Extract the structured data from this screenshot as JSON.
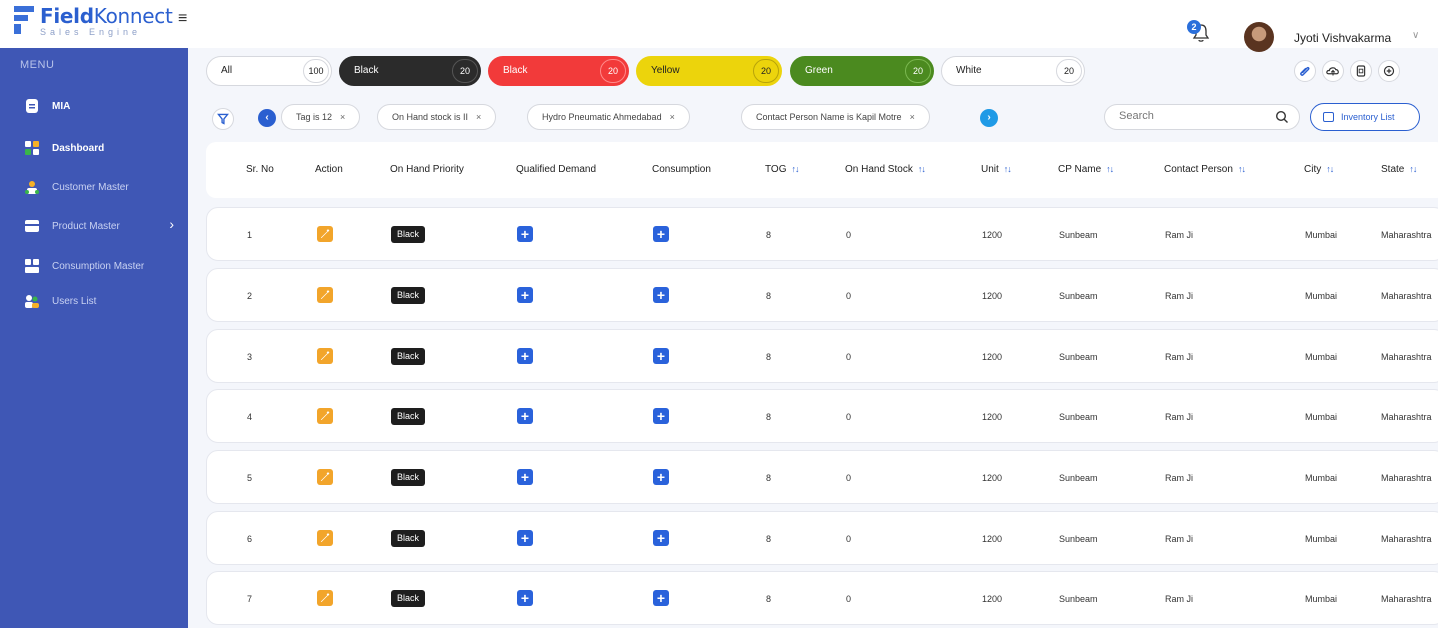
{
  "brand": {
    "name_bold": "Field",
    "name_light": "Konnect",
    "tagline": "Sales Engine",
    "accent": "#2b5fcf"
  },
  "header": {
    "notification_count": "2",
    "user_name": "Jyoti Vishvakarma"
  },
  "sidebar": {
    "menu_title": "MENU",
    "items": [
      {
        "label": "MIA",
        "icon": "document-icon"
      },
      {
        "label": "Dashboard",
        "icon": "dashboard-icon"
      },
      {
        "label": "Customer Master",
        "icon": "customer-icon"
      },
      {
        "label": "Product Master",
        "icon": "product-icon"
      },
      {
        "label": "Consumption Master",
        "icon": "consumption-icon"
      },
      {
        "label": "Users List",
        "icon": "users-icon"
      }
    ]
  },
  "color_filters": [
    {
      "label": "All",
      "count": "100",
      "color": "#ffffff"
    },
    {
      "label": "Black",
      "count": "20",
      "color": "#2b2b2b"
    },
    {
      "label": "Black",
      "count": "20",
      "color": "#f23a3a"
    },
    {
      "label": "Yellow",
      "count": "20",
      "color": "#ecd40c"
    },
    {
      "label": "Green",
      "count": "20",
      "color": "#4b8a1f"
    },
    {
      "label": "White",
      "count": "20",
      "color": "#ffffff"
    }
  ],
  "active_filters": [
    {
      "label": "Tag is 12"
    },
    {
      "label": "On Hand stock is II"
    },
    {
      "label": "Hydro Pneumatic Ahmedabad"
    },
    {
      "label": "Contact Person Name is Kapil Motre"
    }
  ],
  "search": {
    "placeholder": "Search"
  },
  "inventory_button": {
    "label": "Inventory List"
  },
  "table": {
    "columns": [
      "Sr. No",
      "Action",
      "On Hand Priority",
      "Qualified Demand",
      "Consumption",
      "TOG",
      "On Hand Stock",
      "Unit",
      "CP Name",
      "Contact Person",
      "City",
      "State"
    ],
    "rows": [
      {
        "sr": "1",
        "priority": "Black",
        "tog": "8",
        "stock": "0",
        "unit": "1200",
        "cp_name": "Sunbeam",
        "contact": "Ram Ji",
        "city": "Mumbai",
        "state": "Maharashtra"
      },
      {
        "sr": "2",
        "priority": "Black",
        "tog": "8",
        "stock": "0",
        "unit": "1200",
        "cp_name": "Sunbeam",
        "contact": "Ram Ji",
        "city": "Mumbai",
        "state": "Maharashtra"
      },
      {
        "sr": "3",
        "priority": "Black",
        "tog": "8",
        "stock": "0",
        "unit": "1200",
        "cp_name": "Sunbeam",
        "contact": "Ram Ji",
        "city": "Mumbai",
        "state": "Maharashtra"
      },
      {
        "sr": "4",
        "priority": "Black",
        "tog": "8",
        "stock": "0",
        "unit": "1200",
        "cp_name": "Sunbeam",
        "contact": "Ram Ji",
        "city": "Mumbai",
        "state": "Maharashtra"
      },
      {
        "sr": "5",
        "priority": "Black",
        "tog": "8",
        "stock": "0",
        "unit": "1200",
        "cp_name": "Sunbeam",
        "contact": "Ram Ji",
        "city": "Mumbai",
        "state": "Maharashtra"
      },
      {
        "sr": "6",
        "priority": "Black",
        "tog": "8",
        "stock": "0",
        "unit": "1200",
        "cp_name": "Sunbeam",
        "contact": "Ram Ji",
        "city": "Mumbai",
        "state": "Maharashtra"
      },
      {
        "sr": "7",
        "priority": "Black",
        "tog": "8",
        "stock": "0",
        "unit": "1200",
        "cp_name": "Sunbeam",
        "contact": "Ram Ji",
        "city": "Mumbai",
        "state": "Maharashtra"
      }
    ]
  }
}
